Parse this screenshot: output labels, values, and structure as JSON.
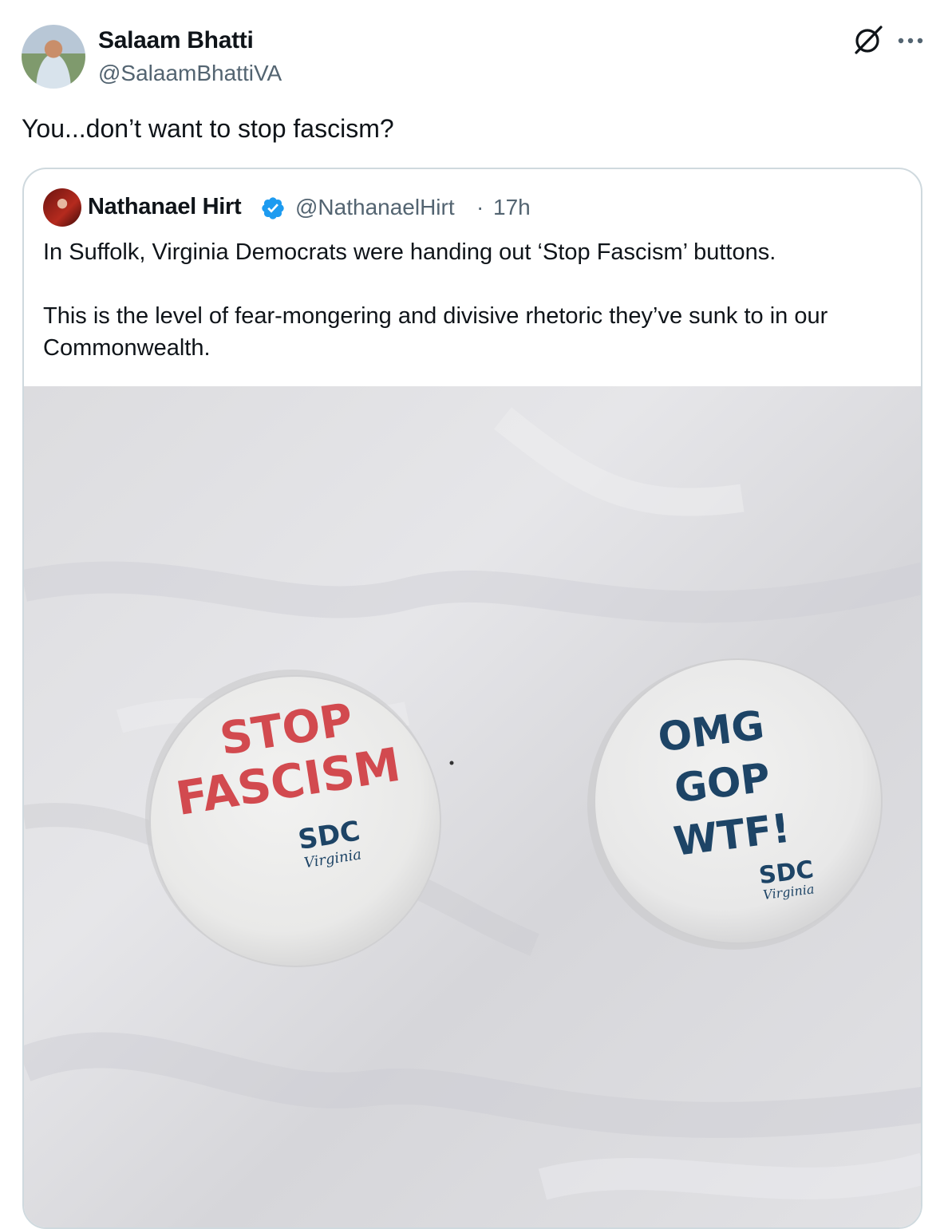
{
  "tweet": {
    "author_name": "Salaam Bhatti",
    "author_handle": "@SalaamBhattiVA",
    "text": "You...don’t want to stop fascism?",
    "icons": [
      "grok-icon",
      "more-icon"
    ]
  },
  "quote": {
    "author_name": "Nathanael Hirt",
    "verified": true,
    "author_handle": "@NathanaelHirt",
    "separator": "·",
    "time": "17h",
    "paragraphs": [
      "In Suffolk, Virginia Democrats were handing out ‘Stop Fascism’ buttons.",
      "This is the level of fear-mongering and divisive rhetoric they’ve sunk to in our Commonwealth."
    ],
    "photo": {
      "button_left": {
        "line1": "STOP",
        "line2": "FASCISM",
        "logo_top": "SDC",
        "logo_bottom": "Virginia",
        "text_color": "#d24a4f"
      },
      "button_right": {
        "line1": "OMG",
        "line2": "GOP",
        "line3": "WTF!",
        "logo_top": "SDC",
        "logo_bottom": "Virginia",
        "text_color": "#1d4466"
      }
    }
  },
  "colors": {
    "secondary_text": "#536471",
    "verified_blue": "#1d9bf0",
    "border": "#cfd9de"
  }
}
